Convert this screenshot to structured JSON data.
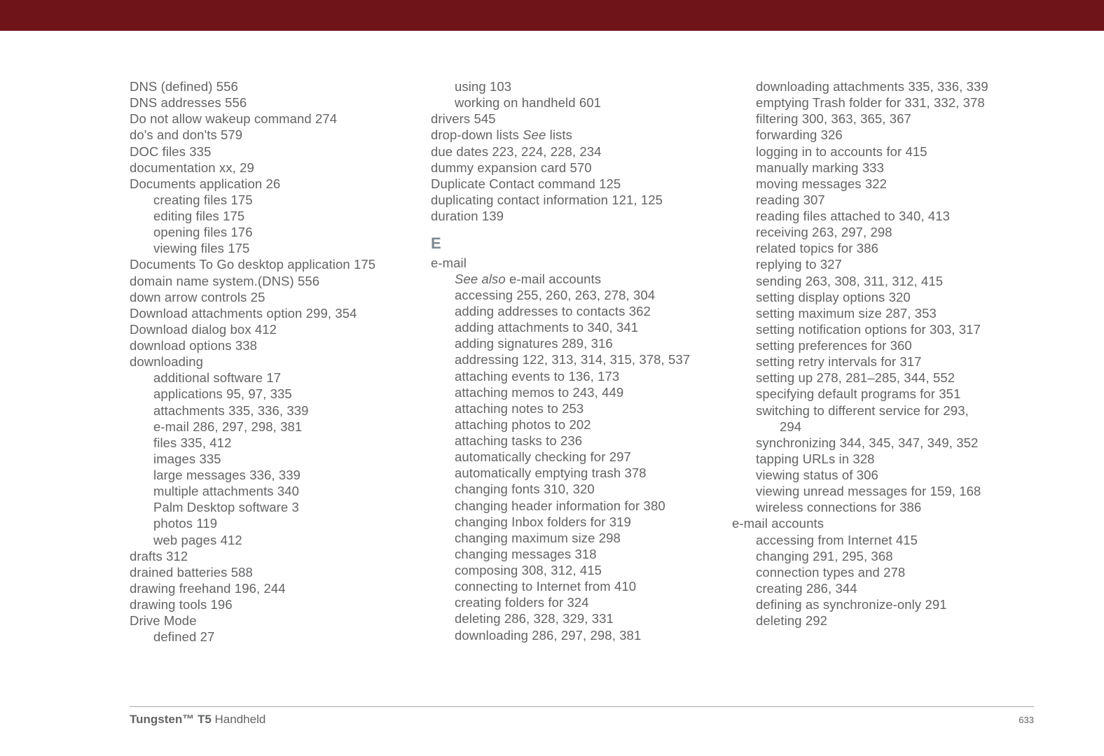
{
  "banner_color": "#6f1419",
  "footer": {
    "title_bold": "Tungsten™ T5",
    "title_rest": " Handheld",
    "page_number": "633"
  },
  "columns": [
    {
      "lines": [
        {
          "t": "DNS (defined) 556"
        },
        {
          "t": "DNS addresses 556"
        },
        {
          "t": "Do not allow wakeup command 274"
        },
        {
          "t": "do's and don'ts 579"
        },
        {
          "t": "DOC files 335"
        },
        {
          "t": "documentation xx, 29"
        },
        {
          "t": "Documents application 26"
        },
        {
          "t": "creating files 175",
          "i": 1
        },
        {
          "t": "editing files 175",
          "i": 1
        },
        {
          "t": "opening files 176",
          "i": 1
        },
        {
          "t": "viewing files 175",
          "i": 1
        },
        {
          "t": "Documents To Go desktop application 175"
        },
        {
          "t": "domain name system.(DNS) 556"
        },
        {
          "t": "down arrow controls 25"
        },
        {
          "t": "Download attachments option 299, 354"
        },
        {
          "t": "Download dialog box 412"
        },
        {
          "t": "download options 338"
        },
        {
          "t": "downloading"
        },
        {
          "t": "additional software 17",
          "i": 1
        },
        {
          "t": "applications 95, 97, 335",
          "i": 1
        },
        {
          "t": "attachments 335, 336, 339",
          "i": 1
        },
        {
          "t": "e-mail 286, 297, 298, 381",
          "i": 1
        },
        {
          "t": "files 335, 412",
          "i": 1
        },
        {
          "t": "images 335",
          "i": 1
        },
        {
          "t": "large messages 336, 339",
          "i": 1
        },
        {
          "t": "multiple attachments 340",
          "i": 1
        },
        {
          "t": "Palm Desktop software 3",
          "i": 1
        },
        {
          "t": "photos 119",
          "i": 1
        },
        {
          "t": "web pages 412",
          "i": 1
        },
        {
          "t": "drafts 312"
        },
        {
          "t": "drained batteries 588"
        },
        {
          "t": "drawing freehand 196, 244"
        },
        {
          "t": "drawing tools 196"
        },
        {
          "t": "Drive Mode"
        },
        {
          "t": "defined 27",
          "i": 1
        }
      ]
    },
    {
      "lines": [
        {
          "t": "using 103",
          "i": 1
        },
        {
          "t": "working on handheld 601",
          "i": 1
        },
        {
          "t": "drivers 545"
        },
        {
          "parts": [
            {
              "t": "drop-down lists "
            },
            {
              "t": "See",
              "italic": true
            },
            {
              "t": " lists"
            }
          ]
        },
        {
          "t": "due dates 223, 224, 228, 234"
        },
        {
          "t": "dummy expansion card 570"
        },
        {
          "t": "Duplicate Contact command 125"
        },
        {
          "t": "duplicating contact information 121, 125"
        },
        {
          "t": "duration 139"
        },
        {
          "letter": "E"
        },
        {
          "t": "e-mail"
        },
        {
          "parts": [
            {
              "t": "See also",
              "italic": true
            },
            {
              "t": " e-mail accounts"
            }
          ],
          "i": 1
        },
        {
          "t": "accessing 255, 260, 263, 278, 304",
          "i": 1
        },
        {
          "t": "adding addresses to contacts 362",
          "i": 1
        },
        {
          "t": "adding attachments to 340, 341",
          "i": 1
        },
        {
          "t": "adding signatures 289, 316",
          "i": 1
        },
        {
          "t": "addressing 122, 313, 314, 315, 378, 537",
          "i": 1
        },
        {
          "t": "attaching events to 136, 173",
          "i": 1
        },
        {
          "t": "attaching memos to 243, 449",
          "i": 1
        },
        {
          "t": "attaching notes to 253",
          "i": 1
        },
        {
          "t": "attaching photos to 202",
          "i": 1
        },
        {
          "t": "attaching tasks to 236",
          "i": 1
        },
        {
          "t": "automatically checking for 297",
          "i": 1
        },
        {
          "t": "automatically emptying trash 378",
          "i": 1
        },
        {
          "t": "changing fonts 310, 320",
          "i": 1
        },
        {
          "t": "changing header information for 380",
          "i": 1
        },
        {
          "t": "changing Inbox folders for 319",
          "i": 1
        },
        {
          "t": "changing maximum size 298",
          "i": 1
        },
        {
          "t": "changing messages 318",
          "i": 1
        },
        {
          "t": "composing 308, 312, 415",
          "i": 1
        },
        {
          "t": "connecting to Internet from 410",
          "i": 1
        },
        {
          "t": "creating folders for 324",
          "i": 1
        },
        {
          "t": "deleting 286, 328, 329, 331",
          "i": 1
        },
        {
          "t": "downloading 286, 297, 298, 381",
          "i": 1
        }
      ]
    },
    {
      "lines": [
        {
          "t": "downloading attachments 335, 336, 339",
          "i": 1
        },
        {
          "t": "emptying Trash folder for 331, 332, 378",
          "i": 1
        },
        {
          "t": "filtering 300, 363, 365, 367",
          "i": 1
        },
        {
          "t": "forwarding 326",
          "i": 1
        },
        {
          "t": "logging in to accounts for 415",
          "i": 1
        },
        {
          "t": "manually marking 333",
          "i": 1
        },
        {
          "t": "moving messages 322",
          "i": 1
        },
        {
          "t": "reading 307",
          "i": 1
        },
        {
          "t": "reading files attached to 340, 413",
          "i": 1
        },
        {
          "t": "receiving 263, 297, 298",
          "i": 1
        },
        {
          "t": "related topics for 386",
          "i": 1
        },
        {
          "t": "replying to 327",
          "i": 1
        },
        {
          "t": "sending 263, 308, 311, 312, 415",
          "i": 1
        },
        {
          "t": "setting display options 320",
          "i": 1
        },
        {
          "t": "setting maximum size 287, 353",
          "i": 1
        },
        {
          "t": "setting notification options for 303, 317",
          "i": 1
        },
        {
          "t": "setting preferences for 360",
          "i": 1
        },
        {
          "t": "setting retry intervals for 317",
          "i": 1
        },
        {
          "t": "setting up 278, 281–285, 344, 552",
          "i": 1
        },
        {
          "t": "specifying default programs for 351",
          "i": 1
        },
        {
          "t": "switching to different service for 293, ",
          "i": 1
        },
        {
          "t": "294",
          "i": 2
        },
        {
          "t": "synchronizing 344, 345, 347, 349, 352",
          "i": 1
        },
        {
          "t": "tapping URLs in 328",
          "i": 1
        },
        {
          "t": "viewing status of 306",
          "i": 1
        },
        {
          "t": "viewing unread messages for 159, 168",
          "i": 1
        },
        {
          "t": "wireless connections for 386",
          "i": 1
        },
        {
          "t": "e-mail accounts"
        },
        {
          "t": "accessing from Internet 415",
          "i": 1
        },
        {
          "t": "changing 291, 295, 368",
          "i": 1
        },
        {
          "t": "connection types and 278",
          "i": 1
        },
        {
          "t": "creating 286, 344",
          "i": 1
        },
        {
          "t": "defining as synchronize-only 291",
          "i": 1
        },
        {
          "t": "deleting 292",
          "i": 1
        }
      ]
    }
  ]
}
